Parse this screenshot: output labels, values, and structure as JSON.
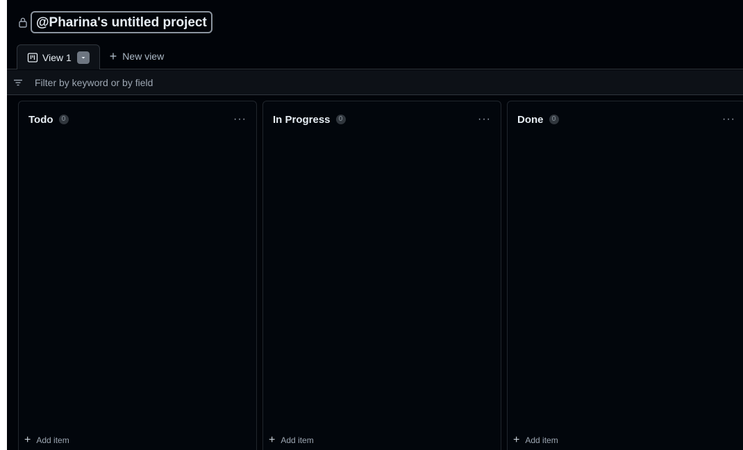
{
  "project": {
    "title": "@Pharina's untitled project",
    "lock_icon": "lock-icon"
  },
  "tabs": {
    "active": {
      "label": "View 1",
      "icon": "board-icon"
    },
    "new_view_label": "New view"
  },
  "filter": {
    "placeholder": "Filter by keyword or by field",
    "icon": "filter-icon"
  },
  "columns": [
    {
      "title": "Todo",
      "count": "0",
      "menu": "···",
      "add_label": "Add item"
    },
    {
      "title": "In Progress",
      "count": "0",
      "menu": "···",
      "add_label": "Add item"
    },
    {
      "title": "Done",
      "count": "0",
      "menu": "···",
      "add_label": "Add item"
    }
  ],
  "colors": {
    "background": "#010409",
    "border": "#30363d",
    "text": "#e6edf3",
    "muted": "#9da7b3"
  }
}
